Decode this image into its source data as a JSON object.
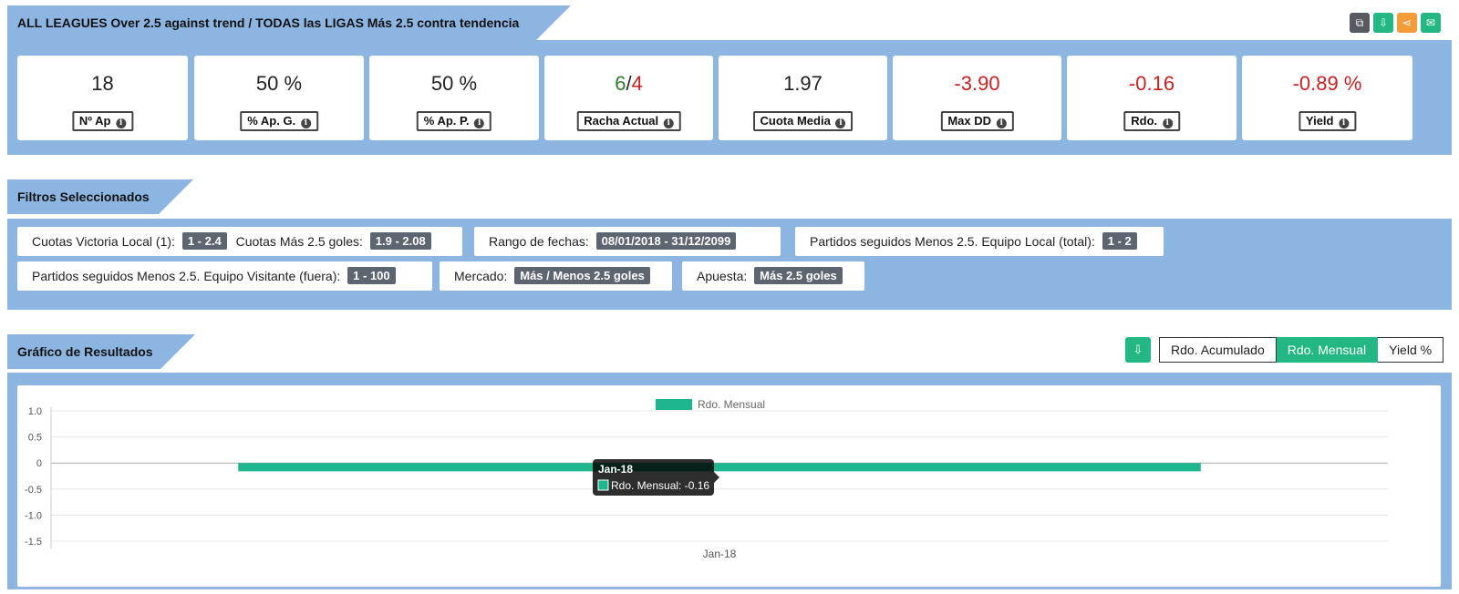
{
  "header": {
    "title": "ALL LEAGUES Over 2.5 against trend / TODAS las LIGAS Más 2.5 contra tendencia",
    "icons": [
      "copy-icon",
      "download-icon",
      "share-icon",
      "email-icon"
    ]
  },
  "stats": [
    {
      "value": "18",
      "label": "Nº Ap",
      "neg": false
    },
    {
      "value": "50 %",
      "label": "% Ap. G.",
      "neg": false
    },
    {
      "value": "50 %",
      "label": "% Ap. P.",
      "neg": false
    },
    {
      "value_win": "6",
      "value_sep": "/",
      "value_loss": "4",
      "label": "Racha Actual"
    },
    {
      "value": "1.97",
      "label": "Cuota Media",
      "neg": false
    },
    {
      "value": "-3.90",
      "label": "Max DD",
      "neg": true
    },
    {
      "value": "-0.16",
      "label": "Rdo.",
      "neg": true
    },
    {
      "value": "-0.89 %",
      "label": "Yield",
      "neg": true
    }
  ],
  "filters": {
    "title": "Filtros Seleccionados",
    "chips": [
      {
        "label1": "Cuotas Victoria Local (1):",
        "badge1": "1 - 2.4",
        "label2": "Cuotas Más 2.5 goles:",
        "badge2": "1.9 - 2.08"
      },
      {
        "label1": "Rango de fechas:",
        "badge1": "08/01/2018 - 31/12/2099"
      },
      {
        "label1": "Partidos seguidos Menos 2.5. Equipo Local (total):",
        "badge1": "1 - 2"
      },
      {
        "label1": "Partidos seguidos Menos 2.5. Equipo Visitante (fuera):",
        "badge1": "1 - 100"
      },
      {
        "label1": "Mercado:",
        "badge1": "Más / Menos 2.5 goles"
      },
      {
        "label1": "Apuesta:",
        "badge1": "Más 2.5 goles"
      }
    ]
  },
  "results": {
    "title": "Gráfico de Resultados",
    "toggles": [
      "Rdo. Acumulado",
      "Rdo. Mensual",
      "Yield %"
    ],
    "active_toggle": "Rdo. Mensual"
  },
  "chart_data": {
    "type": "bar",
    "categories": [
      "Jan-18"
    ],
    "series": [
      {
        "name": "Rdo. Mensual",
        "values": [
          -0.16
        ],
        "color": "#1eb68c"
      }
    ],
    "ylim": [
      -1.5,
      1.0
    ],
    "yticks": [
      "1.0",
      "0.5",
      "0",
      "-0.5",
      "-1.0",
      "-1.5"
    ],
    "legend": "top-center",
    "grid": true,
    "tooltip": {
      "title": "Jan-18",
      "text": "Rdo. Mensual: -0.16"
    }
  },
  "colors": {
    "panel": "#8db5e2",
    "positive": "#2f7d2f",
    "negative": "#cc1f1f",
    "accent": "#23b783"
  }
}
